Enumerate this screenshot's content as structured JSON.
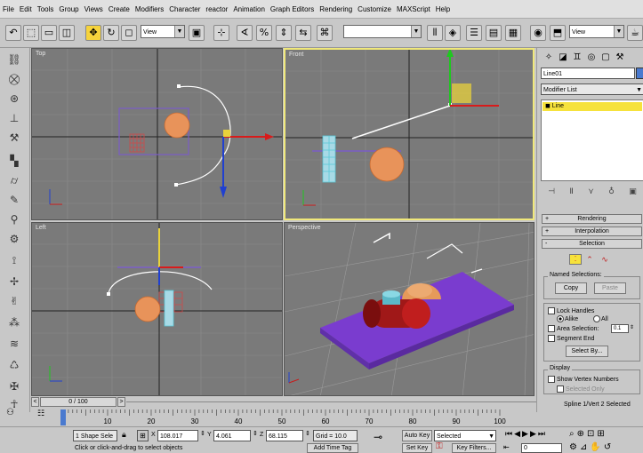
{
  "menu": [
    "File",
    "Edit",
    "Tools",
    "Group",
    "Views",
    "Create",
    "Modifiers",
    "Character",
    "reactor",
    "Animation",
    "Graph Editors",
    "Rendering",
    "Customize",
    "MAXScript",
    "Help"
  ],
  "toolbar": {
    "view_dropdown": "View",
    "view_dropdown2": "View"
  },
  "viewports": {
    "top": "Top",
    "front": "Front",
    "left": "Left",
    "perspective": "Perspective"
  },
  "panel": {
    "object_name": "Line01",
    "modifier_list": "Modifier List",
    "stack_item": "Line",
    "rollouts": {
      "rendering": "Rendering",
      "interpolation": "Interpolation",
      "selection": "Selection"
    },
    "named_selections": "Named Selections:",
    "copy": "Copy",
    "paste": "Paste",
    "lock_handles": "Lock Handles",
    "alike": "Alike",
    "all": "All",
    "area_selection": "Area Selection:",
    "area_value": "0.1",
    "segment_end": "Segment End",
    "select_by": "Select By...",
    "display": "Display",
    "show_vertex_numbers": "Show Vertex Numbers",
    "selected_only": "Selected Only",
    "spline_status": "Spline 1/Vert 2 Selected"
  },
  "timeline": {
    "frame": "0 / 100",
    "ticks": [
      "10",
      "20",
      "30",
      "40",
      "50",
      "60",
      "70",
      "80",
      "90",
      "100"
    ]
  },
  "status": {
    "shape_sel": "1 Shape Sele",
    "x_label": "X",
    "x": "108.017",
    "y_label": "Y",
    "y": "4.061",
    "z_label": "Z",
    "z": "68.115",
    "grid": "Grid = 10.0",
    "auto_key": "Auto Key",
    "selected": "Selected",
    "set_key": "Set Key",
    "key_filters": "Key Filters...",
    "prompt": "Click or click-and-drag to select objects",
    "add_time_tag": "Add Time Tag",
    "frame_field": "0"
  }
}
